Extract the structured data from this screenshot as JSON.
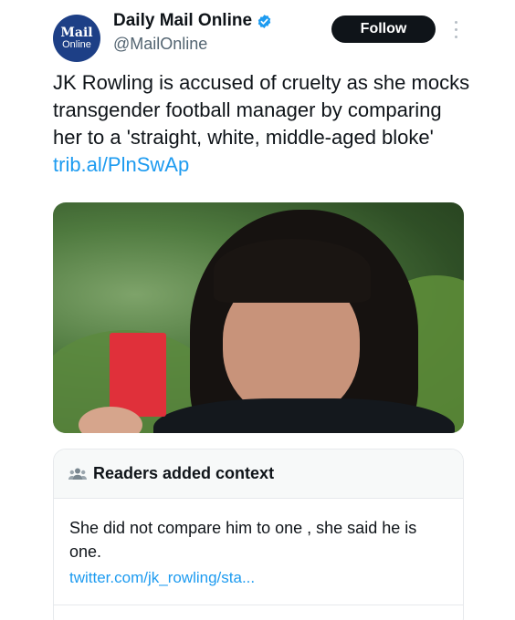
{
  "account": {
    "logo_top": "Mail",
    "logo_bottom": "Online",
    "display_name": "Daily Mail Online",
    "handle": "@MailOnline",
    "verified_icon": "verified-badge-icon",
    "avatar_color": "#1d3f86"
  },
  "actions": {
    "follow_label": "Follow",
    "more_icon": "more-vertical-icon"
  },
  "tweet": {
    "text": "JK Rowling is accused of cruelty as she mocks transgender football manager by comparing her to a 'straight, white, middle-aged bloke'",
    "link": "trib.al/PlnSwAp",
    "link_color": "#1d9bf0"
  },
  "media": {
    "description_icon": "photo-person-red-card"
  },
  "context": {
    "icon": "people-icon",
    "title": "Readers added context",
    "text": "She did not compare him to one , she said he is one.",
    "link": "twitter.com/jk_rowling/sta..."
  }
}
